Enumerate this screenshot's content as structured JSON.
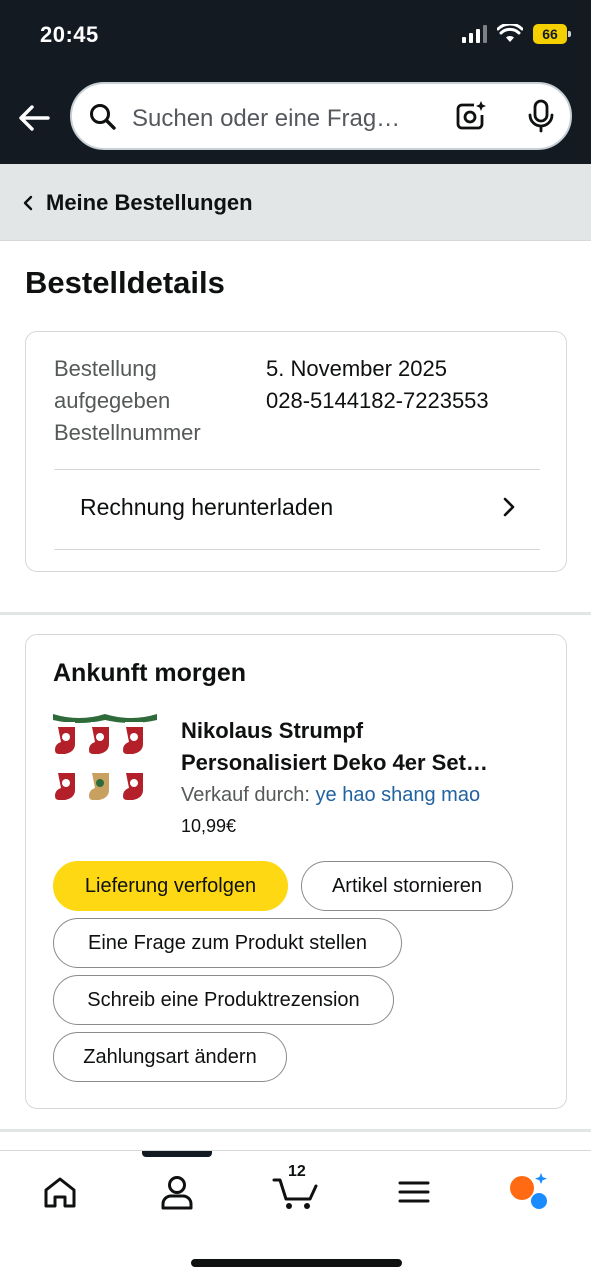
{
  "status_bar": {
    "time": "20:45",
    "battery": "66"
  },
  "search": {
    "placeholder": "Suchen oder eine Frag…"
  },
  "breadcrumb": {
    "label": "Meine Bestellungen"
  },
  "page": {
    "title": "Bestelldetails"
  },
  "order": {
    "placed_label_line1": "Bestellung",
    "placed_label_line2": "aufgegeben",
    "number_label": "Bestellnummer",
    "placed_value": "5. November 2025",
    "number_value": "028-5144182-7223553",
    "invoice_label": "Rechnung herunterladen"
  },
  "shipment": {
    "arrival": "Ankunft morgen",
    "product_title_line1": "Nikolaus Strumpf",
    "product_title_line2": "Personalisiert Deko 4er Set…",
    "seller_prefix": "Verkauf durch:",
    "seller_name": "ye hao shang mao",
    "price": "10,99€",
    "buttons": {
      "track": "Lieferung verfolgen",
      "cancel": "Artikel stornieren",
      "question": "Eine Frage zum Produkt stellen",
      "review": "Schreib eine Produktrezension",
      "payment": "Zahlungsart ändern"
    }
  },
  "tabbar": {
    "cart_count": "12"
  },
  "colors": {
    "header_bg": "#131a22",
    "primary_button": "#ffd814",
    "link": "#2162a1",
    "breadcrumb_bg": "#e3e6e6"
  }
}
